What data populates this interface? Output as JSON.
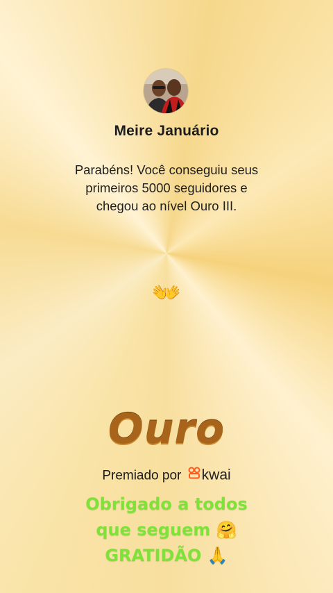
{
  "profile": {
    "name": "Meire Januário",
    "avatar_icon": "profile-photo"
  },
  "message": {
    "line1": "Parabéns! Você conseguiu seus",
    "line2": "primeiros 5000 seguidores e",
    "line3": "chegou ao nível Ouro III."
  },
  "decoration": {
    "hands": "👐",
    "icon_name": "pointing-hands-icon"
  },
  "badge": {
    "level": "Ouro",
    "color": "#a8641a"
  },
  "award": {
    "prefix": "Premiado por",
    "brand": "kwai",
    "brand_color": "#ff5a1f"
  },
  "caption": {
    "line1": "Obrigado a todos",
    "line2": "que seguem 🤗",
    "line3": "GRATIDÃO 🙏",
    "color": "#7fe23b"
  }
}
